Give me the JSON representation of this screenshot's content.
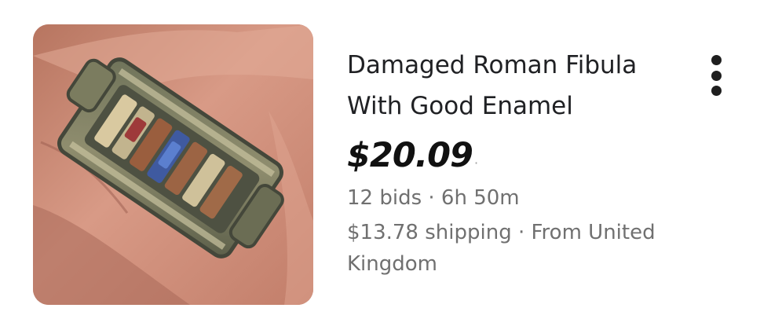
{
  "listing": {
    "image_alt": "Damaged Roman Fibula With Good Enamel",
    "title": "Damaged Roman Fibula With Good Enamel",
    "price": "$20.09",
    "price_suffix": "·",
    "bids_time": "12 bids · 6h 50m",
    "shipping_origin": "$13.78 shipping · From United Kingdom",
    "more_icon": "more-vertical-icon"
  }
}
